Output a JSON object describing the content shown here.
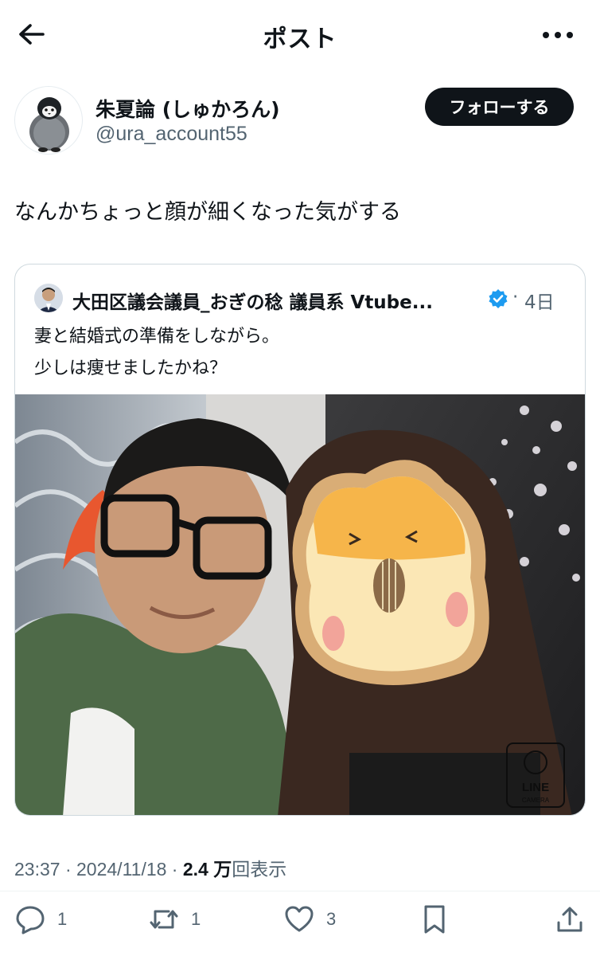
{
  "header": {
    "title": "ポスト",
    "back_icon": "arrow-left-icon",
    "more_icon": "more-horizontal-icon"
  },
  "author": {
    "name": "朱夏論 (しゅかろん)",
    "handle": "@ura_account55",
    "follow_label": "フォローする",
    "avatar_icon": "penguin-avatar"
  },
  "post": {
    "text": "なんかちょっと顔が細くなった気がする"
  },
  "quote": {
    "name": "大田区議会議員_おぎの稔 議員系 Vtube...",
    "separator": "·",
    "time": "4日",
    "verified_color": "#1d9bf0",
    "lines": [
      "妻と結婚式の準備をしながら。",
      "少しは痩せましたかね？"
    ],
    "image_watermark": [
      "LINE",
      "CAMERA"
    ]
  },
  "meta": {
    "time": "23:37",
    "dot1": " · ",
    "date": "2024/11/18",
    "dot2": " · ",
    "views": "2.4 万",
    "views_label": "回表示"
  },
  "actions": {
    "reply_count": "1",
    "retweet_count": "1",
    "like_count": "3"
  },
  "colors": {
    "text": "#0f1419",
    "secondary": "#536471",
    "accent": "#1d9bf0"
  }
}
